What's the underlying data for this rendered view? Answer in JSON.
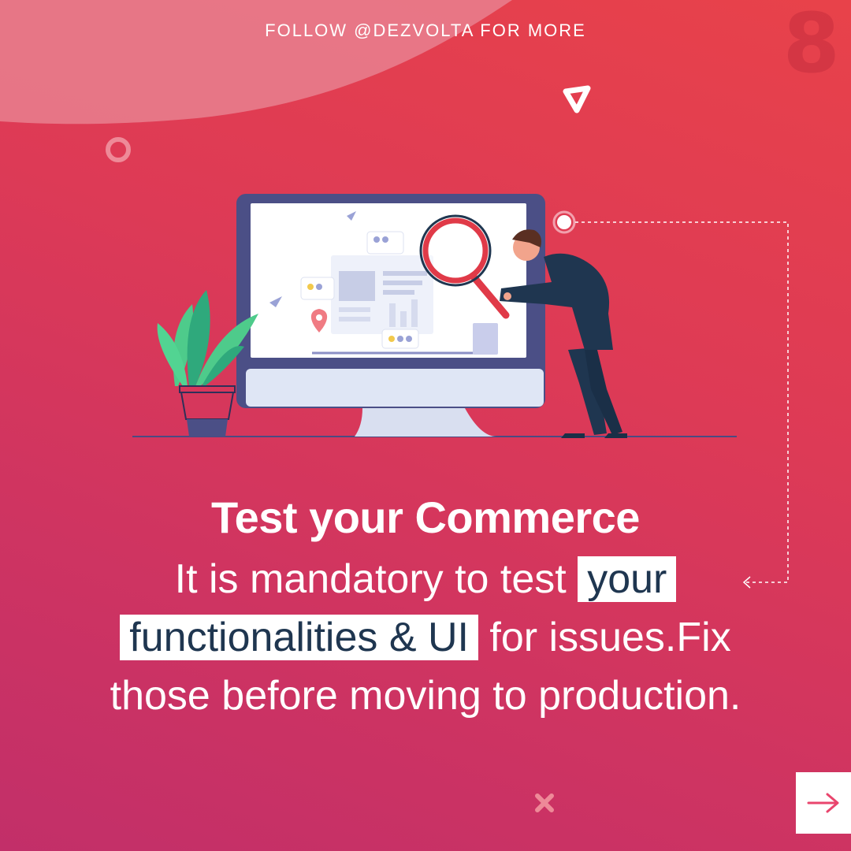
{
  "header": {
    "follow_text": "FOLLOW @DEZVOLTA FOR MORE",
    "page_number": "8"
  },
  "content": {
    "title": "Test your Commerce",
    "body": {
      "part1": "It is mandatory to test",
      "highlight1": "your",
      "highlight2": "functionalities & UI",
      "part2": "for issues.Fix",
      "part3": "those before moving to production."
    }
  },
  "navigation": {
    "next_icon": "arrow-right-icon"
  },
  "illustration": {
    "subject": "person-with-magnifying-glass-inspecting-monitor",
    "plant": "potted-plant"
  },
  "colors": {
    "background_top": "#e8424a",
    "background_bottom": "#c22f69",
    "highlight_bg": "#ffffff",
    "highlight_text": "#1f3650",
    "figure_dark": "#1f3650",
    "magnifier": "#e03a48",
    "plant": "#4ecb8b",
    "arrow": "#e9456d"
  }
}
